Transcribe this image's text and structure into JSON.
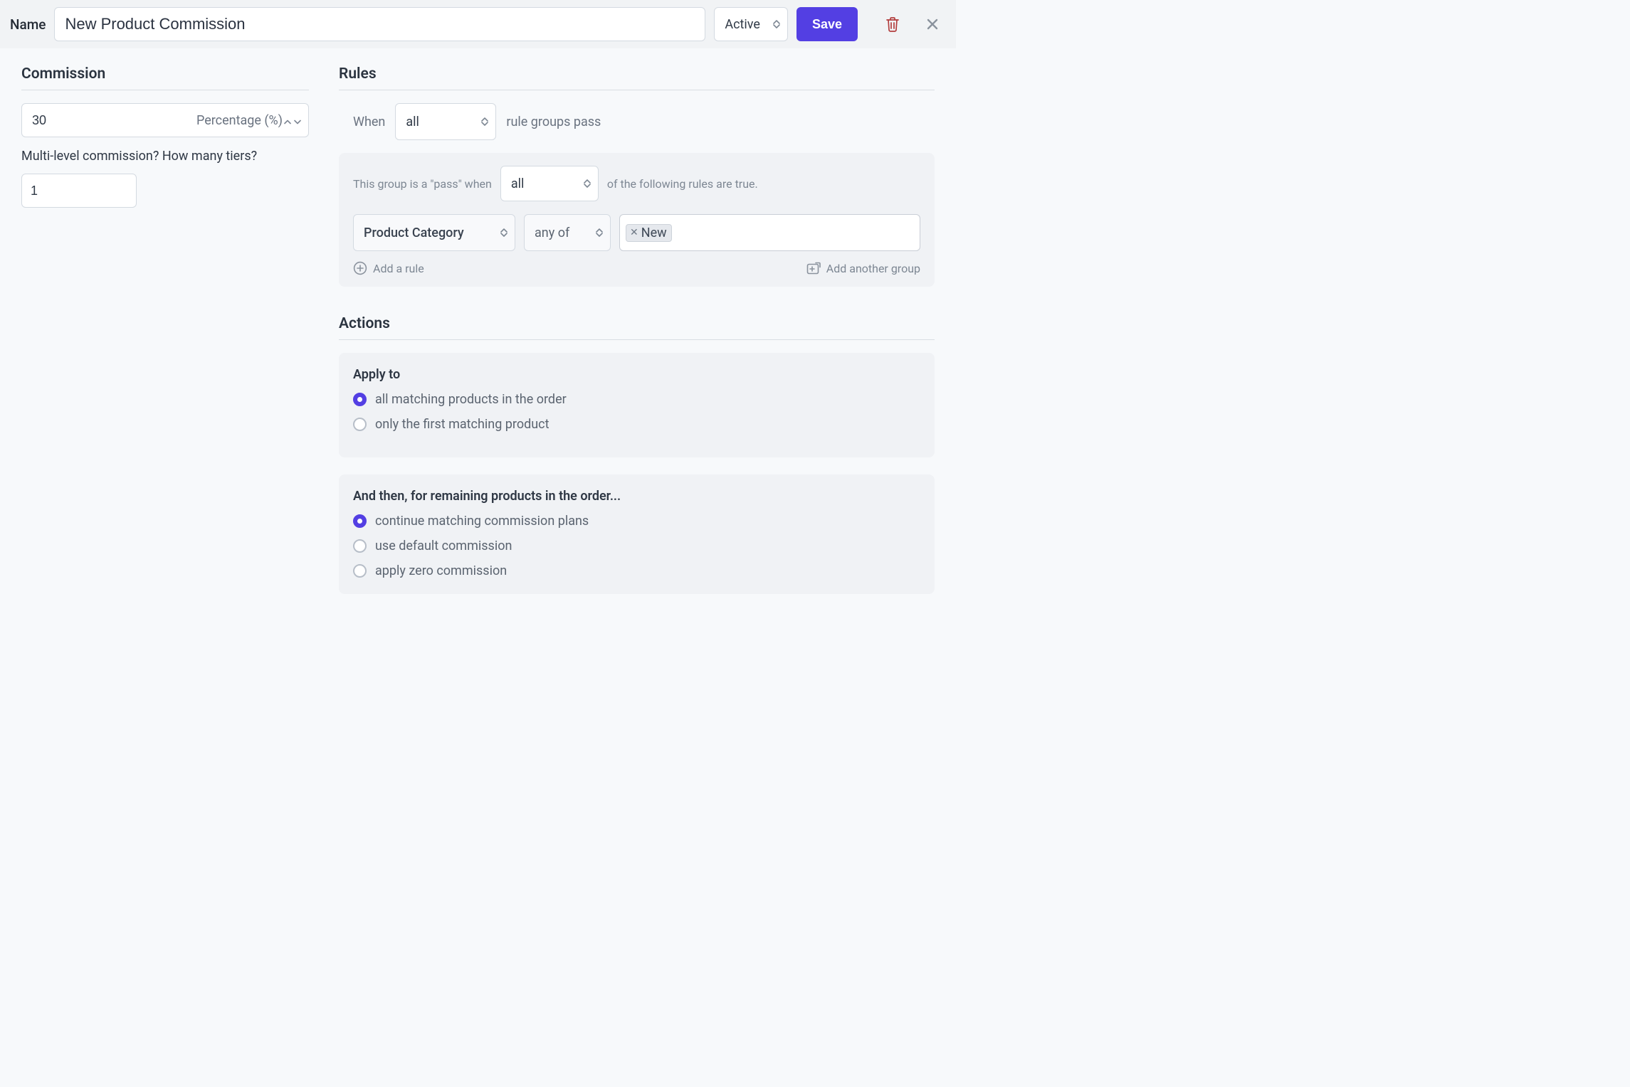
{
  "header": {
    "name_label": "Name",
    "name_value": "New Product Commission",
    "status": "Active",
    "save": "Save"
  },
  "commission": {
    "title": "Commission",
    "value": "30",
    "type": "Percentage (%)",
    "tier_label": "Multi-level commission? How many tiers?",
    "tier_value": "1"
  },
  "rules": {
    "title": "Rules",
    "when_prefix": "When",
    "when_mode": "all",
    "when_suffix": "rule groups pass",
    "group": {
      "prefix": "This group is a \"pass\" when",
      "mode": "all",
      "suffix": "of the following rules are true.",
      "rule_subject": "Product Category",
      "rule_op": "any of",
      "tokens": [
        "New"
      ],
      "add_rule": "Add a rule",
      "add_group": "Add another group"
    }
  },
  "actions": {
    "title": "Actions",
    "apply_to": {
      "label": "Apply to",
      "options": [
        {
          "label": "all matching products in the order",
          "selected": true
        },
        {
          "label": "only the first matching product",
          "selected": false
        }
      ]
    },
    "remaining": {
      "label": "And then, for remaining products in the order...",
      "options": [
        {
          "label": "continue matching commission plans",
          "selected": true
        },
        {
          "label": "use default commission",
          "selected": false
        },
        {
          "label": "apply zero commission",
          "selected": false
        }
      ]
    }
  }
}
